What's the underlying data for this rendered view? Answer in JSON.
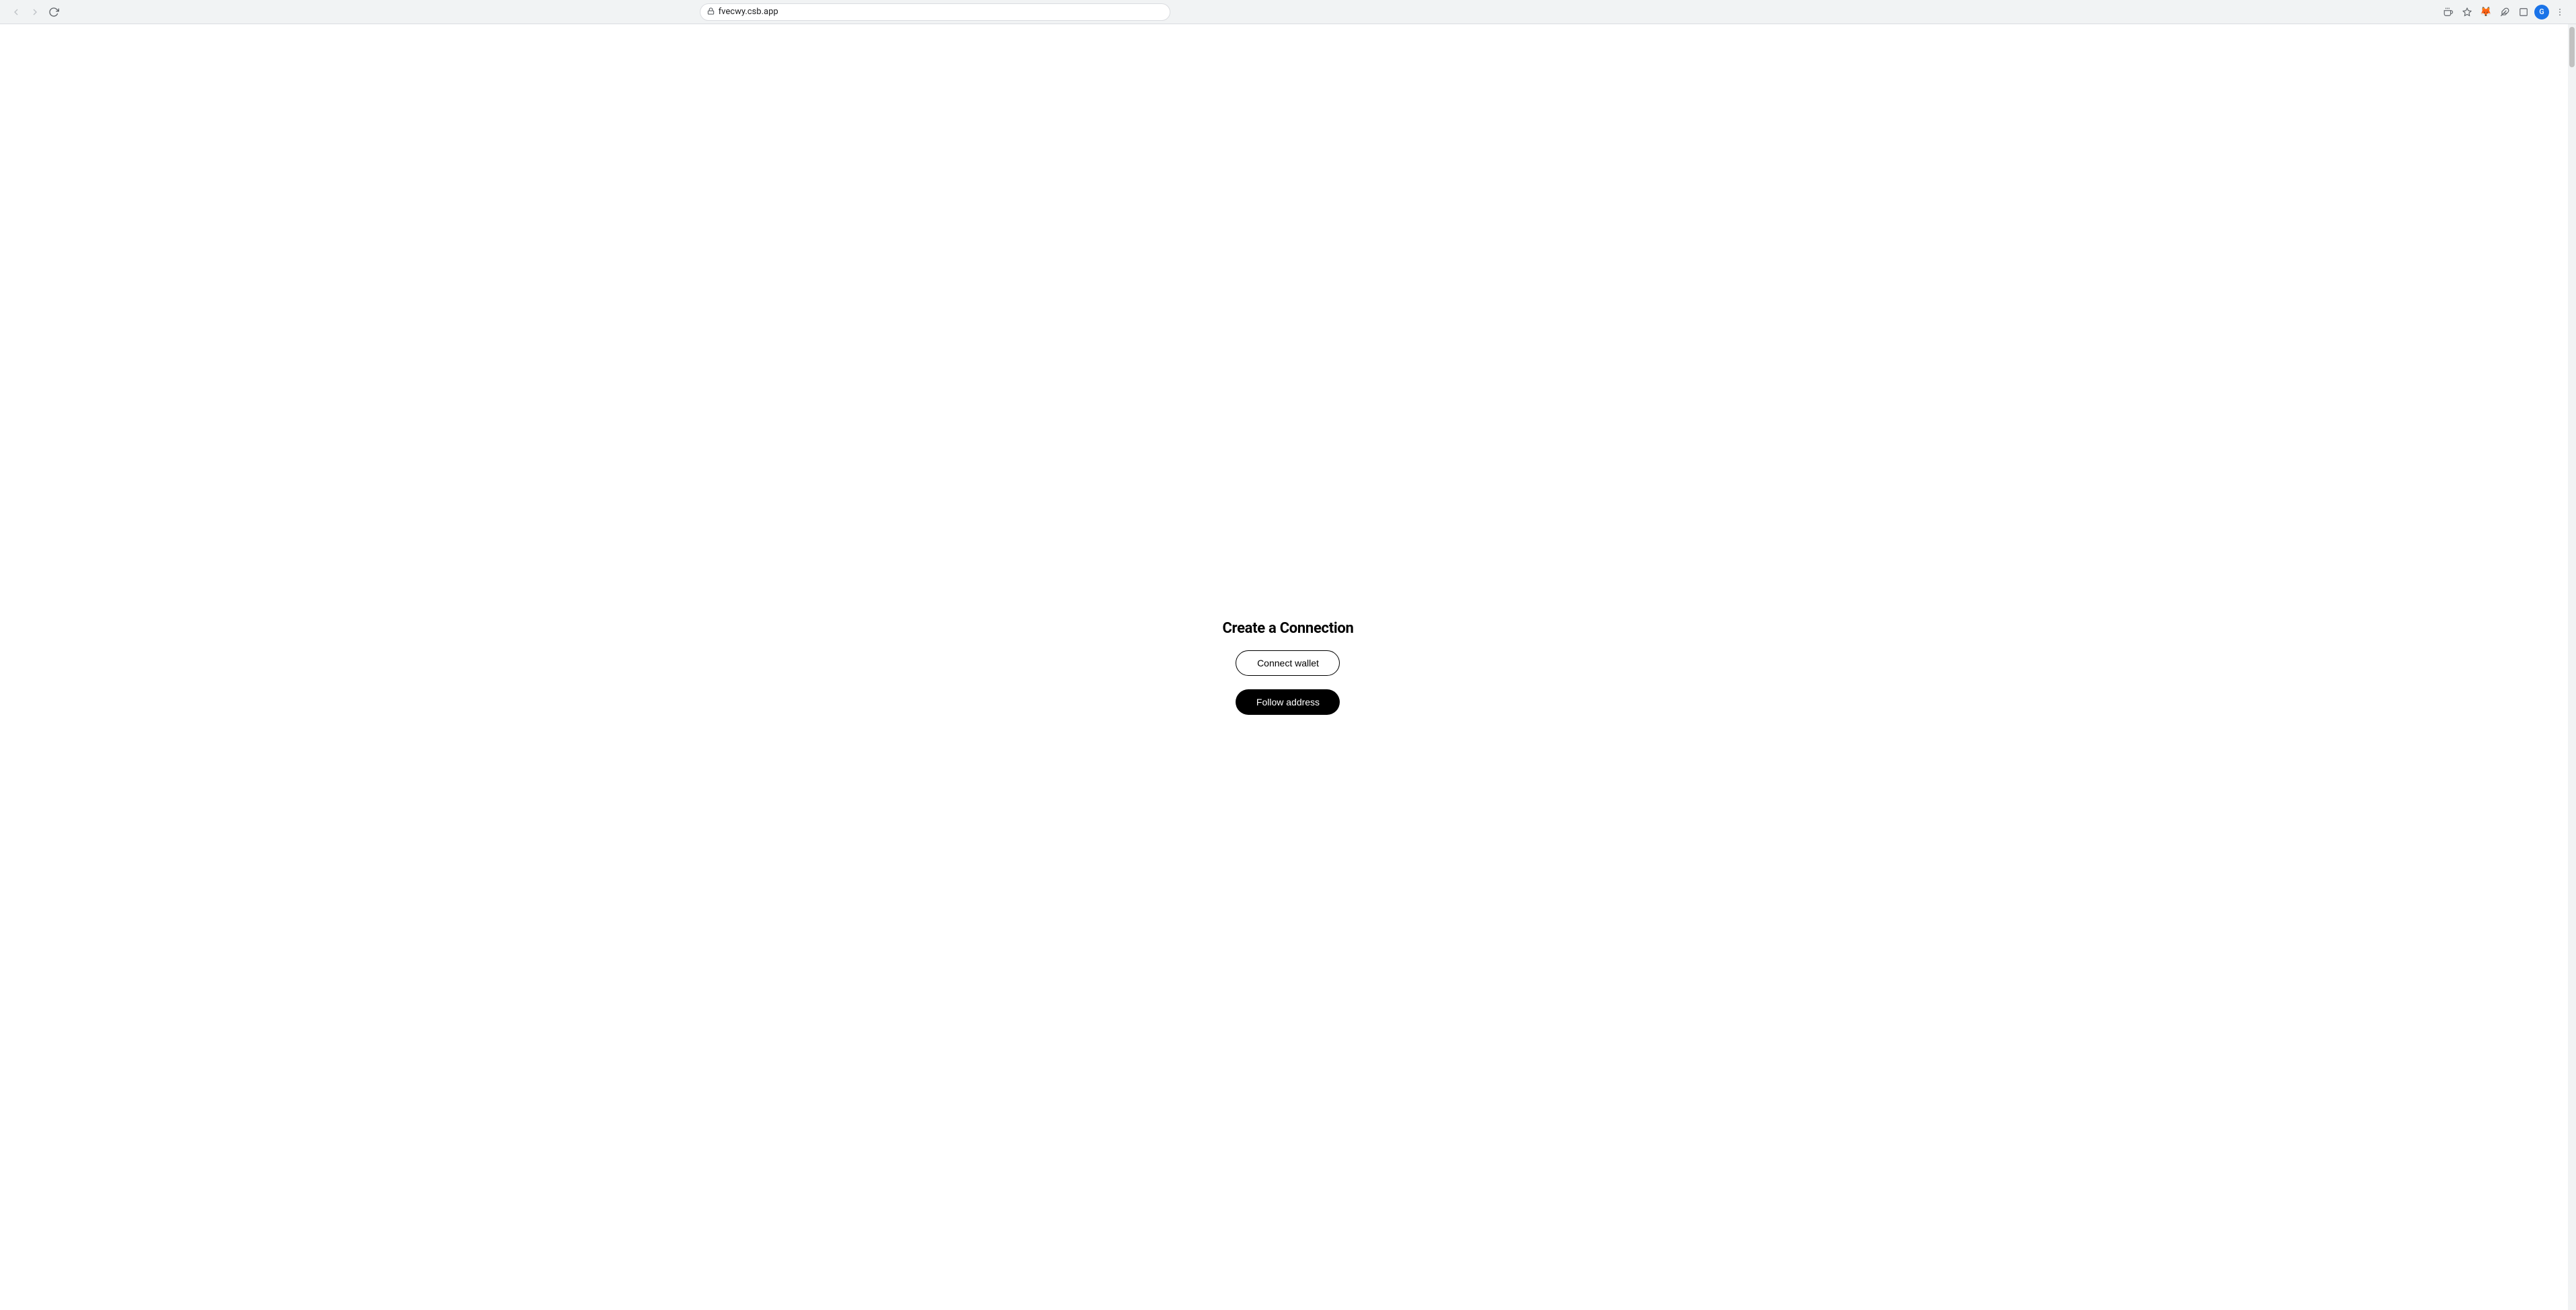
{
  "browser": {
    "url": "fvecwy.csb.app",
    "nav": {
      "back_disabled": true,
      "forward_disabled": true,
      "reload_label": "⟳"
    },
    "actions": {
      "screen_share": "⬒",
      "cast": "⊡",
      "bookmark": "☆",
      "extensions": "🧩",
      "pin": "📌",
      "window": "⬜",
      "more": "⋮"
    }
  },
  "page": {
    "heading": "Create a Connection",
    "connect_wallet_label": "Connect wallet",
    "follow_address_label": "Follow address"
  },
  "colors": {
    "connect_wallet_bg": "#ffffff",
    "connect_wallet_border": "#000000",
    "connect_wallet_text": "#000000",
    "follow_address_bg": "#000000",
    "follow_address_text": "#ffffff"
  }
}
